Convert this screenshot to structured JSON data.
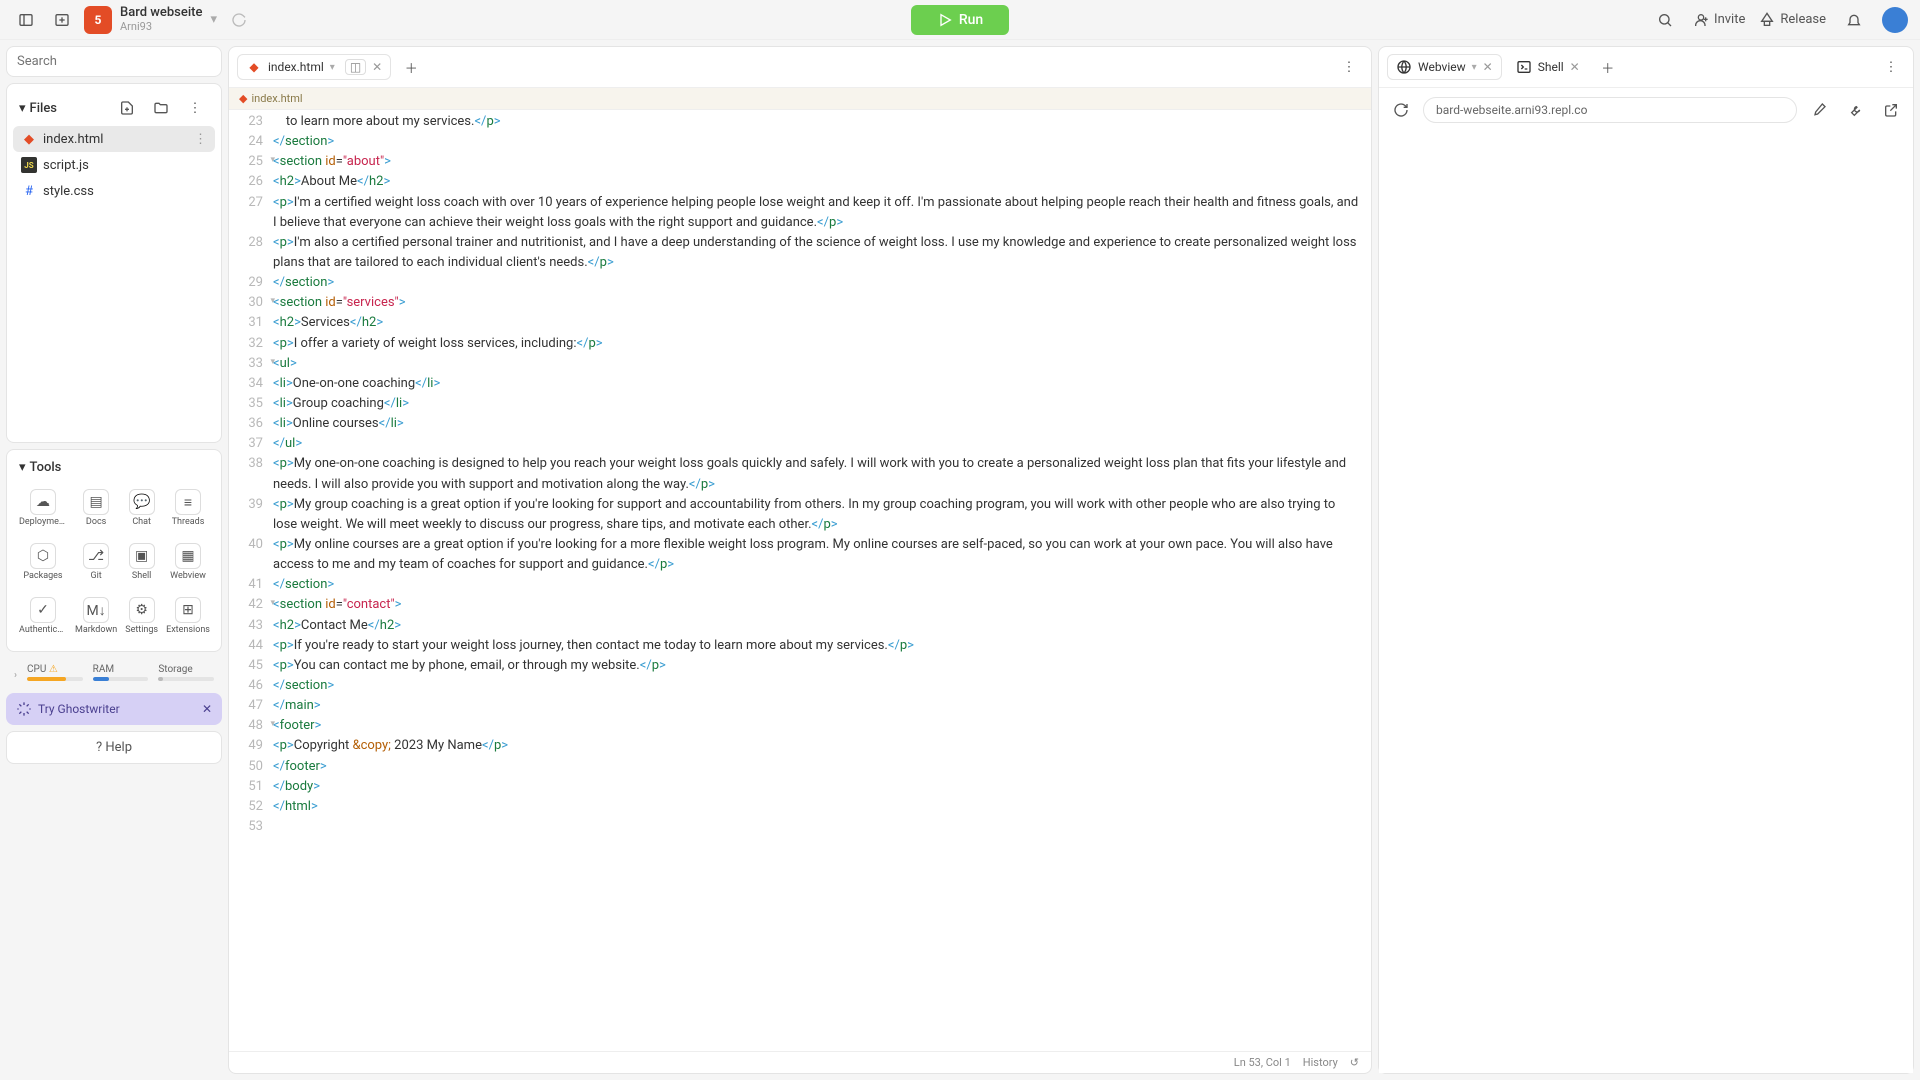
{
  "header": {
    "project_title": "Bard webseite",
    "owner": "Arni93",
    "run_label": "Run",
    "invite_label": "Invite",
    "release_label": "Release"
  },
  "sidebar": {
    "search_placeholder": "Search",
    "files_label": "Files",
    "files": [
      "index.html",
      "script.js",
      "style.css"
    ],
    "tools_label": "Tools",
    "tools": [
      "Deployments",
      "Docs",
      "Chat",
      "Threads",
      "Packages",
      "Git",
      "Shell",
      "Webview",
      "Authenticati...",
      "Markdown",
      "Settings",
      "Extensions"
    ],
    "resources": {
      "cpu": "CPU",
      "ram": "RAM",
      "storage": "Storage",
      "cpu_pct": 70,
      "ram_pct": 30,
      "storage_pct": 8
    },
    "ghostwriter": "Try Ghostwriter",
    "help": "Help"
  },
  "editor": {
    "tab_label": "index.html",
    "breadcrumb": "index.html",
    "status": {
      "pos": "Ln 53, Col 1",
      "history": "History"
    },
    "lines": [
      {
        "n": 23,
        "tokens": [
          [
            "txt",
            "    to learn more about my services."
          ],
          [
            "br",
            "</"
          ],
          [
            "tag",
            "p"
          ],
          [
            "br",
            ">"
          ]
        ]
      },
      {
        "n": 24,
        "tokens": [
          [
            "br",
            "</"
          ],
          [
            "tag",
            "section"
          ],
          [
            "br",
            ">"
          ]
        ]
      },
      {
        "n": 25,
        "fold": true,
        "tokens": [
          [
            "br",
            "<"
          ],
          [
            "tag",
            "section"
          ],
          [
            "txt",
            " "
          ],
          [
            "attr",
            "id"
          ],
          [
            "txt",
            "="
          ],
          [
            "str",
            "\"about\""
          ],
          [
            "br",
            ">"
          ]
        ]
      },
      {
        "n": 26,
        "tokens": [
          [
            "br",
            "<"
          ],
          [
            "tag",
            "h2"
          ],
          [
            "br",
            ">"
          ],
          [
            "txt",
            "About Me"
          ],
          [
            "br",
            "</"
          ],
          [
            "tag",
            "h2"
          ],
          [
            "br",
            ">"
          ]
        ]
      },
      {
        "n": 27,
        "tokens": [
          [
            "br",
            "<"
          ],
          [
            "tag",
            "p"
          ],
          [
            "br",
            ">"
          ],
          [
            "txt",
            "I'm a certified weight loss coach with over 10 years of experience helping people lose weight and keep it off. I'm passionate about helping people reach their health and fitness goals, and I believe that everyone can achieve their weight loss goals with the right support and guidance."
          ],
          [
            "br",
            "</"
          ],
          [
            "tag",
            "p"
          ],
          [
            "br",
            ">"
          ]
        ]
      },
      {
        "n": 28,
        "tokens": [
          [
            "br",
            "<"
          ],
          [
            "tag",
            "p"
          ],
          [
            "br",
            ">"
          ],
          [
            "txt",
            "I'm also a certified personal trainer and nutritionist, and I have a deep understanding of the science of weight loss. I use my knowledge and experience to create personalized weight loss plans that are tailored to each individual client's needs."
          ],
          [
            "br",
            "</"
          ],
          [
            "tag",
            "p"
          ],
          [
            "br",
            ">"
          ]
        ]
      },
      {
        "n": 29,
        "tokens": [
          [
            "br",
            "</"
          ],
          [
            "tag",
            "section"
          ],
          [
            "br",
            ">"
          ]
        ]
      },
      {
        "n": 30,
        "fold": true,
        "tokens": [
          [
            "br",
            "<"
          ],
          [
            "tag",
            "section"
          ],
          [
            "txt",
            " "
          ],
          [
            "attr",
            "id"
          ],
          [
            "txt",
            "="
          ],
          [
            "str",
            "\"services\""
          ],
          [
            "br",
            ">"
          ]
        ]
      },
      {
        "n": 31,
        "tokens": [
          [
            "br",
            "<"
          ],
          [
            "tag",
            "h2"
          ],
          [
            "br",
            ">"
          ],
          [
            "txt",
            "Services"
          ],
          [
            "br",
            "</"
          ],
          [
            "tag",
            "h2"
          ],
          [
            "br",
            ">"
          ]
        ]
      },
      {
        "n": 32,
        "tokens": [
          [
            "br",
            "<"
          ],
          [
            "tag",
            "p"
          ],
          [
            "br",
            ">"
          ],
          [
            "txt",
            "I offer a variety of weight loss services, including:"
          ],
          [
            "br",
            "</"
          ],
          [
            "tag",
            "p"
          ],
          [
            "br",
            ">"
          ]
        ]
      },
      {
        "n": 33,
        "fold": true,
        "tokens": [
          [
            "br",
            "<"
          ],
          [
            "tag",
            "ul"
          ],
          [
            "br",
            ">"
          ]
        ]
      },
      {
        "n": 34,
        "tokens": [
          [
            "br",
            "<"
          ],
          [
            "tag",
            "li"
          ],
          [
            "br",
            ">"
          ],
          [
            "txt",
            "One-on-one coaching"
          ],
          [
            "br",
            "</"
          ],
          [
            "tag",
            "li"
          ],
          [
            "br",
            ">"
          ]
        ]
      },
      {
        "n": 35,
        "tokens": [
          [
            "br",
            "<"
          ],
          [
            "tag",
            "li"
          ],
          [
            "br",
            ">"
          ],
          [
            "txt",
            "Group coaching"
          ],
          [
            "br",
            "</"
          ],
          [
            "tag",
            "li"
          ],
          [
            "br",
            ">"
          ]
        ]
      },
      {
        "n": 36,
        "tokens": [
          [
            "br",
            "<"
          ],
          [
            "tag",
            "li"
          ],
          [
            "br",
            ">"
          ],
          [
            "txt",
            "Online courses"
          ],
          [
            "br",
            "</"
          ],
          [
            "tag",
            "li"
          ],
          [
            "br",
            ">"
          ]
        ]
      },
      {
        "n": 37,
        "tokens": [
          [
            "br",
            "</"
          ],
          [
            "tag",
            "ul"
          ],
          [
            "br",
            ">"
          ]
        ]
      },
      {
        "n": 38,
        "tokens": [
          [
            "br",
            "<"
          ],
          [
            "tag",
            "p"
          ],
          [
            "br",
            ">"
          ],
          [
            "txt",
            "My one-on-one coaching is designed to help you reach your weight loss goals quickly and safely. I will work with you to create a personalized weight loss plan that fits your lifestyle and needs. I will also provide you with support and motivation along the way."
          ],
          [
            "br",
            "</"
          ],
          [
            "tag",
            "p"
          ],
          [
            "br",
            ">"
          ]
        ]
      },
      {
        "n": 39,
        "tokens": [
          [
            "br",
            "<"
          ],
          [
            "tag",
            "p"
          ],
          [
            "br",
            ">"
          ],
          [
            "txt",
            "My group coaching is a great option if you're looking for support and accountability from others. In my group coaching program, you will work with other people who are also trying to lose weight. We will meet weekly to discuss our progress, share tips, and motivate each other."
          ],
          [
            "br",
            "</"
          ],
          [
            "tag",
            "p"
          ],
          [
            "br",
            ">"
          ]
        ]
      },
      {
        "n": 40,
        "tokens": [
          [
            "br",
            "<"
          ],
          [
            "tag",
            "p"
          ],
          [
            "br",
            ">"
          ],
          [
            "txt",
            "My online courses are a great option if you're looking for a more flexible weight loss program. My online courses are self-paced, so you can work at your own pace. You will also have access to me and my team of coaches for support and guidance."
          ],
          [
            "br",
            "</"
          ],
          [
            "tag",
            "p"
          ],
          [
            "br",
            ">"
          ]
        ]
      },
      {
        "n": 41,
        "tokens": [
          [
            "br",
            "</"
          ],
          [
            "tag",
            "section"
          ],
          [
            "br",
            ">"
          ]
        ]
      },
      {
        "n": 42,
        "fold": true,
        "tokens": [
          [
            "br",
            "<"
          ],
          [
            "tag",
            "section"
          ],
          [
            "txt",
            " "
          ],
          [
            "attr",
            "id"
          ],
          [
            "txt",
            "="
          ],
          [
            "str",
            "\"contact\""
          ],
          [
            "br",
            ">"
          ]
        ]
      },
      {
        "n": 43,
        "tokens": [
          [
            "br",
            "<"
          ],
          [
            "tag",
            "h2"
          ],
          [
            "br",
            ">"
          ],
          [
            "txt",
            "Contact Me"
          ],
          [
            "br",
            "</"
          ],
          [
            "tag",
            "h2"
          ],
          [
            "br",
            ">"
          ]
        ]
      },
      {
        "n": 44,
        "tokens": [
          [
            "br",
            "<"
          ],
          [
            "tag",
            "p"
          ],
          [
            "br",
            ">"
          ],
          [
            "txt",
            "If you're ready to start your weight loss journey, then contact me today to learn more about my services."
          ],
          [
            "br",
            "</"
          ],
          [
            "tag",
            "p"
          ],
          [
            "br",
            ">"
          ]
        ]
      },
      {
        "n": 45,
        "tokens": [
          [
            "br",
            "<"
          ],
          [
            "tag",
            "p"
          ],
          [
            "br",
            ">"
          ],
          [
            "txt",
            "You can contact me by phone, email, or through my website."
          ],
          [
            "br",
            "</"
          ],
          [
            "tag",
            "p"
          ],
          [
            "br",
            ">"
          ]
        ]
      },
      {
        "n": 46,
        "tokens": [
          [
            "br",
            "</"
          ],
          [
            "tag",
            "section"
          ],
          [
            "br",
            ">"
          ]
        ]
      },
      {
        "n": 47,
        "tokens": [
          [
            "br",
            "</"
          ],
          [
            "tag",
            "main"
          ],
          [
            "br",
            ">"
          ]
        ]
      },
      {
        "n": 48,
        "fold": true,
        "tokens": [
          [
            "br",
            "<"
          ],
          [
            "tag",
            "footer"
          ],
          [
            "br",
            ">"
          ]
        ]
      },
      {
        "n": 49,
        "tokens": [
          [
            "br",
            "<"
          ],
          [
            "tag",
            "p"
          ],
          [
            "br",
            ">"
          ],
          [
            "txt",
            "Copyright "
          ],
          [
            "ent",
            "&copy;"
          ],
          [
            "txt",
            " 2023 My Name"
          ],
          [
            "br",
            "</"
          ],
          [
            "tag",
            "p"
          ],
          [
            "br",
            ">"
          ]
        ]
      },
      {
        "n": 50,
        "tokens": [
          [
            "br",
            "</"
          ],
          [
            "tag",
            "footer"
          ],
          [
            "br",
            ">"
          ]
        ]
      },
      {
        "n": 51,
        "tokens": [
          [
            "br",
            "</"
          ],
          [
            "tag",
            "body"
          ],
          [
            "br",
            ">"
          ]
        ]
      },
      {
        "n": 52,
        "tokens": [
          [
            "br",
            "</"
          ],
          [
            "tag",
            "html"
          ],
          [
            "br",
            ">"
          ]
        ]
      },
      {
        "n": 53,
        "tokens": []
      }
    ]
  },
  "preview": {
    "webview_tab": "Webview",
    "shell_tab": "Shell",
    "url": "bard-webseite.arni93.repl.co"
  },
  "colors": {
    "run": "#6ccf4f",
    "html": "#e34c26",
    "cpu": "#f5a623",
    "ram": "#3a7fd5",
    "storage": "#bbb"
  }
}
